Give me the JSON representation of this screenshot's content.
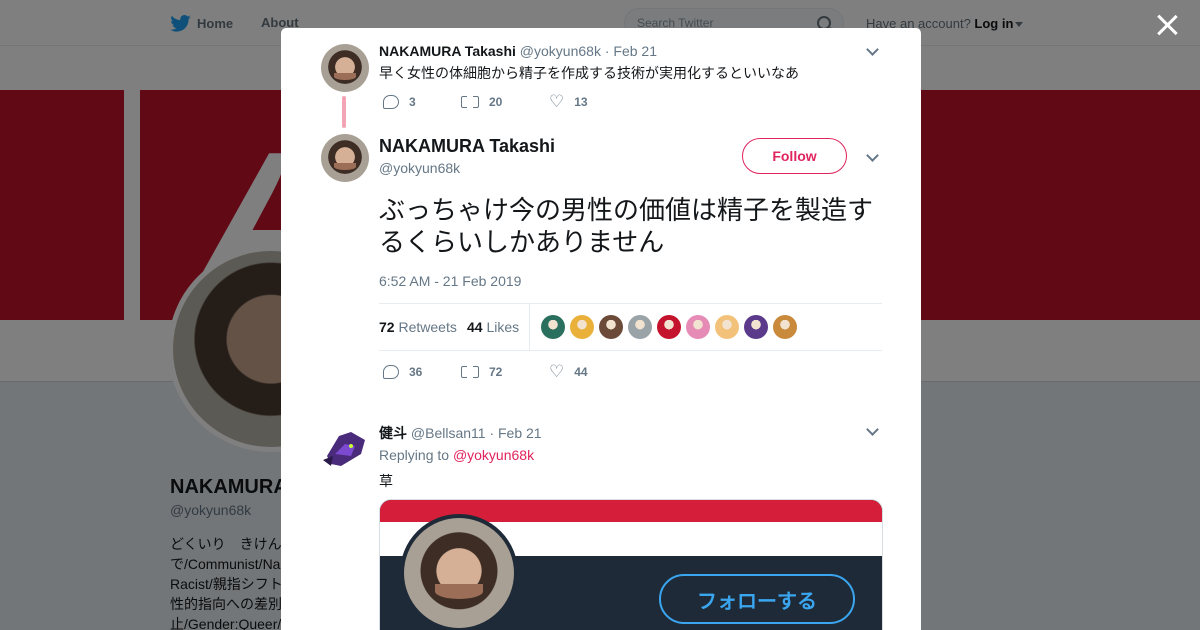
{
  "nav": {
    "home_label": "Home",
    "about_label": "About",
    "search_placeholder": "Search Twitter",
    "have_account": "Have an account?",
    "login_label": "Log in"
  },
  "profile": {
    "name": "NAKAMURA",
    "handle": "@yokyun68k",
    "bio_lines": [
      "どくいり　きけん",
      "で/Communist/Na",
      "Racist/親指シフト",
      "性的指向への差別",
      "止/Gender:Queer/"
    ]
  },
  "parent_tweet": {
    "name": "NAKAMURA Takashi",
    "handle": "@yokyun68k",
    "date": "· Feb 21",
    "text": "早く女性の体細胞から精子を作成する技術が実用化するといいなあ",
    "replies": "3",
    "retweets": "20",
    "likes": "13"
  },
  "main_tweet": {
    "name": "NAKAMURA Takashi",
    "handle": "@yokyun68k",
    "follow_label": "Follow",
    "text": "ぶっちゃけ今の男性の価値は精子を製造するくらいしかありません",
    "timestamp": "6:52 AM - 21 Feb 2019",
    "retweet_count": "72",
    "retweet_label": "Retweets",
    "like_count": "44",
    "like_label": "Likes",
    "replies": "36",
    "retweets": "72",
    "likes": "44",
    "liker_colors": [
      "#2b6f5e",
      "#e9b13a",
      "#6b4a3a",
      "#9aa3a8",
      "#c4132d",
      "#e58bb6",
      "#f3c27a",
      "#5b3a8c",
      "#c98a3c"
    ]
  },
  "reply_tweet": {
    "name": "健斗",
    "handle": "@Bellsan11",
    "date": "· Feb 21",
    "replying_to_label": "Replying to",
    "mention": "@yokyun68k",
    "text": "草",
    "media_follow_label": "フォローする"
  }
}
